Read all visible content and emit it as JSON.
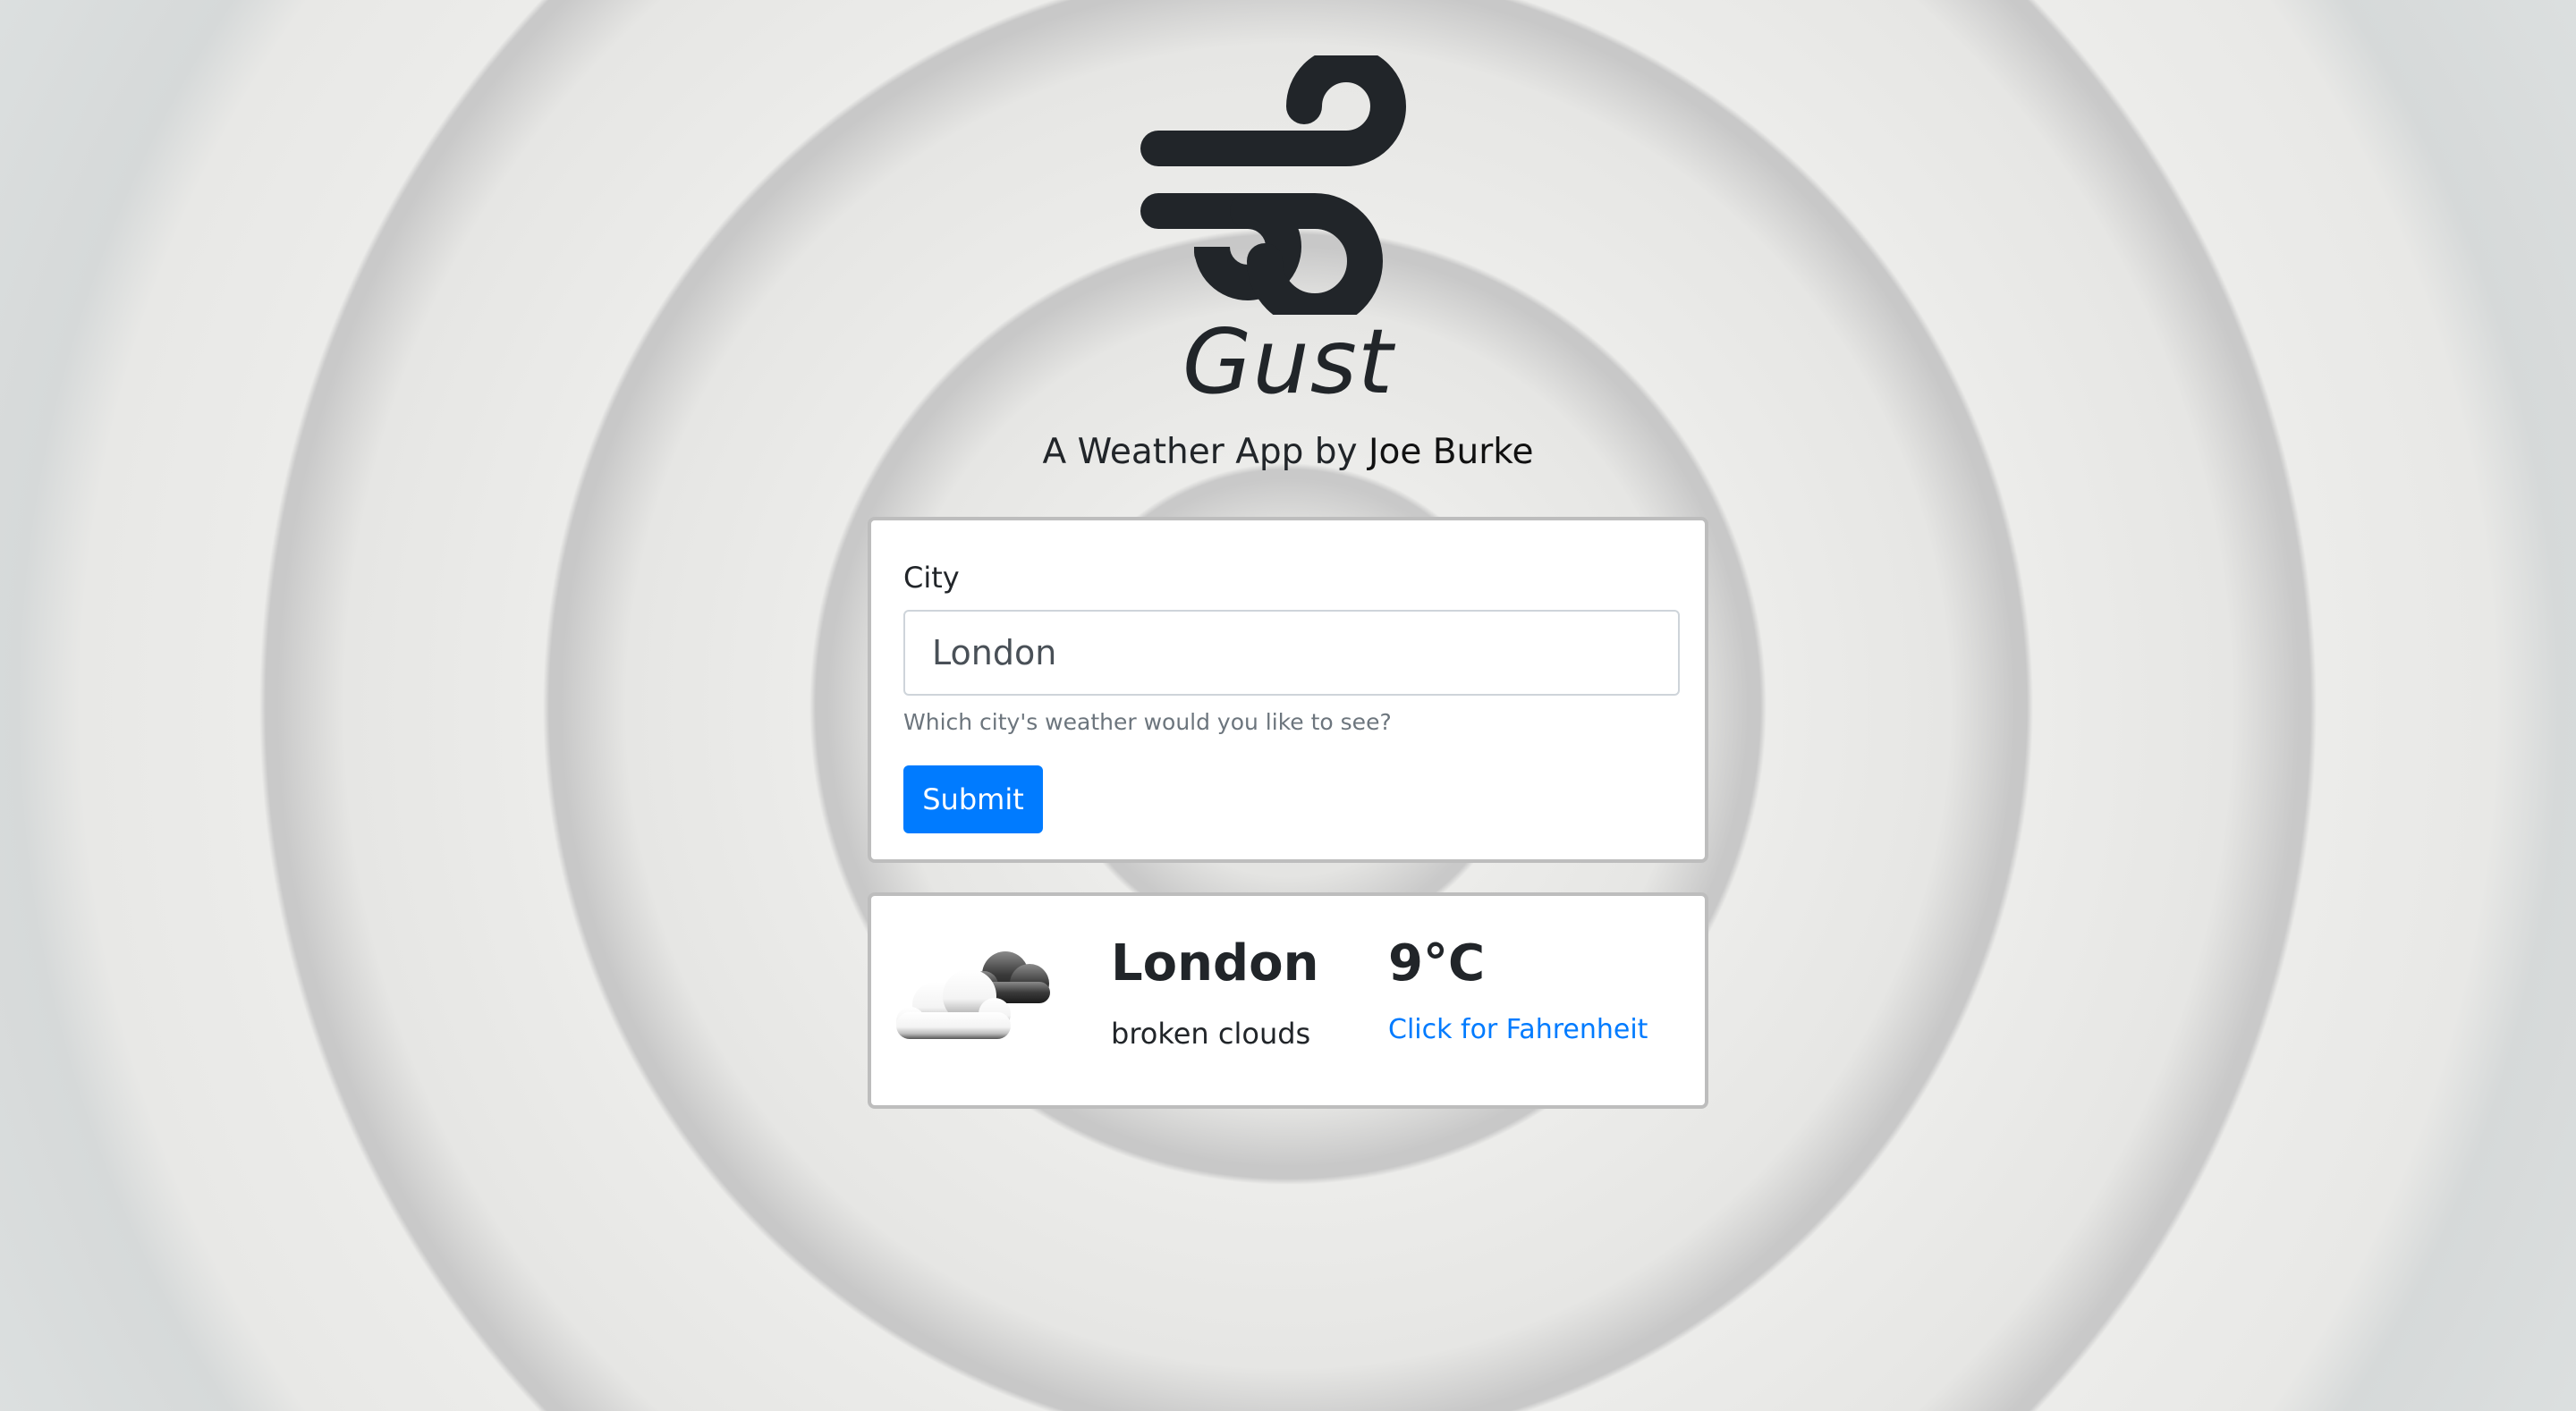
{
  "app": {
    "title": "Gust",
    "subtitle_prefix": "A Weather App by ",
    "author": "Joe Burke",
    "logo_icon": "wind-icon"
  },
  "form": {
    "city_label": "City",
    "city_value": "London",
    "help_text": "Which city's weather would you like to see?",
    "submit_label": "Submit"
  },
  "weather": {
    "icon": "broken-clouds-icon",
    "city": "London",
    "description": "broken clouds",
    "temperature": "9°C",
    "toggle_label": "Click for Fahrenheit"
  },
  "colors": {
    "primary": "#007bff",
    "text": "#212529",
    "muted": "#6c757d"
  }
}
